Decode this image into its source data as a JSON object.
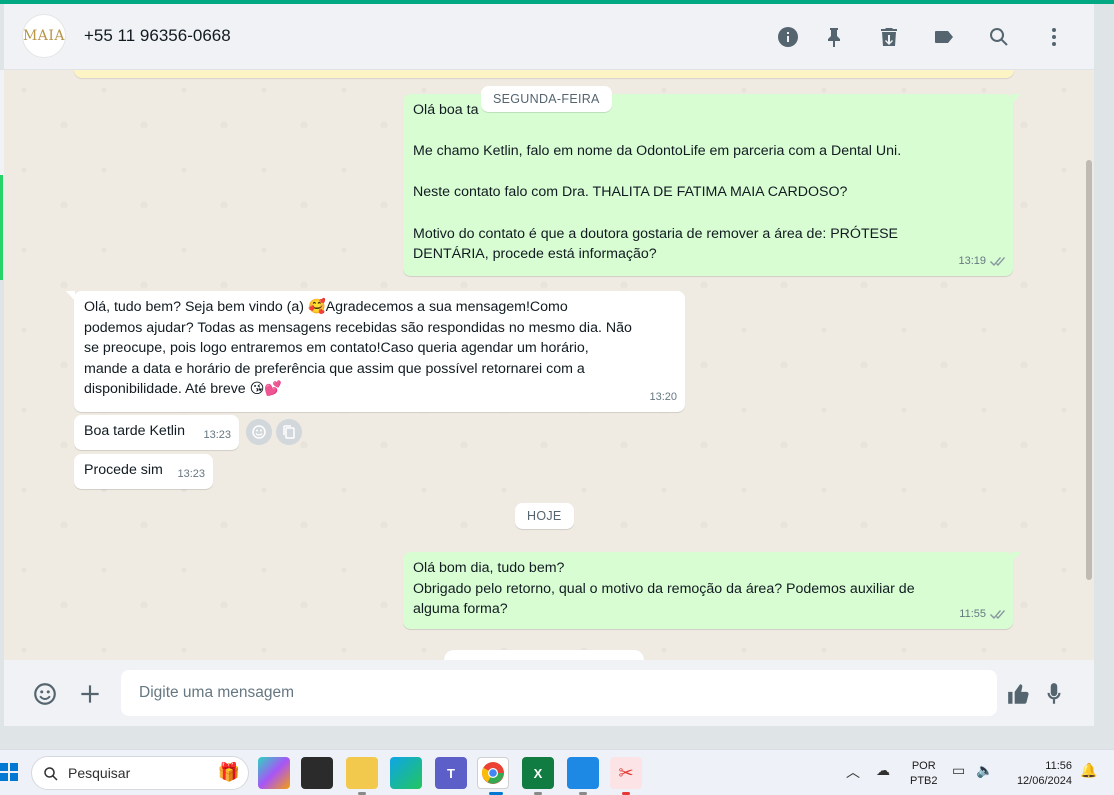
{
  "header": {
    "avatar_text": "MAIA",
    "contact_name": "+55 11 96356-0668",
    "icons": [
      "info-icon",
      "pin-icon",
      "delete-icon",
      "label-icon",
      "search-icon",
      "menu-icon"
    ]
  },
  "chat": {
    "chip_monday": "SEGUNDA-FEIRA",
    "chip_today": "HOJE",
    "messages": [
      {
        "direction": "out",
        "text": "Olá boa ta\n\nMe chamo Ketlin, falo em nome da OdontoLife em parceria com a Dental Uni.\n\nNeste contato falo com Dra. THALITA DE FATIMA MAIA CARDOSO?\n\nMotivo do contato é que a doutora gostaria de remover a área de: PRÓTESE\nDENTÁRIA, procede está informação?",
        "time": "13:19"
      },
      {
        "direction": "in",
        "text": "Olá, tudo bem? Seja bem vindo (a) 🥰Agradecemos a sua mensagem!Como\npodemos ajudar? Todas as mensagens recebidas são respondidas no mesmo dia. Não\nse preocupe, pois logo entraremos em contato!Caso queria agendar um horário,\nmande a data e horário de preferência que assim que possível retornarei com a\ndisponibilidade. Até breve 😘💕",
        "time": "13:20"
      },
      {
        "direction": "in",
        "text": "Boa tarde Ketlin",
        "time": "13:23"
      },
      {
        "direction": "in",
        "text": "Procede sim",
        "time": "13:23"
      },
      {
        "direction": "out",
        "text": "Olá bom dia, tudo bem?\nObrigado pelo retorno, qual o motivo da remoção da área? Podemos auxiliar de\nalguma forma?",
        "time": "11:55"
      }
    ]
  },
  "footer": {
    "placeholder": "Digite uma mensagem"
  },
  "taskbar": {
    "search_label": "Pesquisar",
    "lang_line1": "POR",
    "lang_line2": "PTB2",
    "time": "11:56",
    "date": "12/06/2024"
  },
  "colors": {
    "accent": "#00a884",
    "bubble_out": "#d9fdd3",
    "bubble_in": "#ffffff",
    "chat_bg": "#efeae2",
    "tick": "#8696a0"
  }
}
